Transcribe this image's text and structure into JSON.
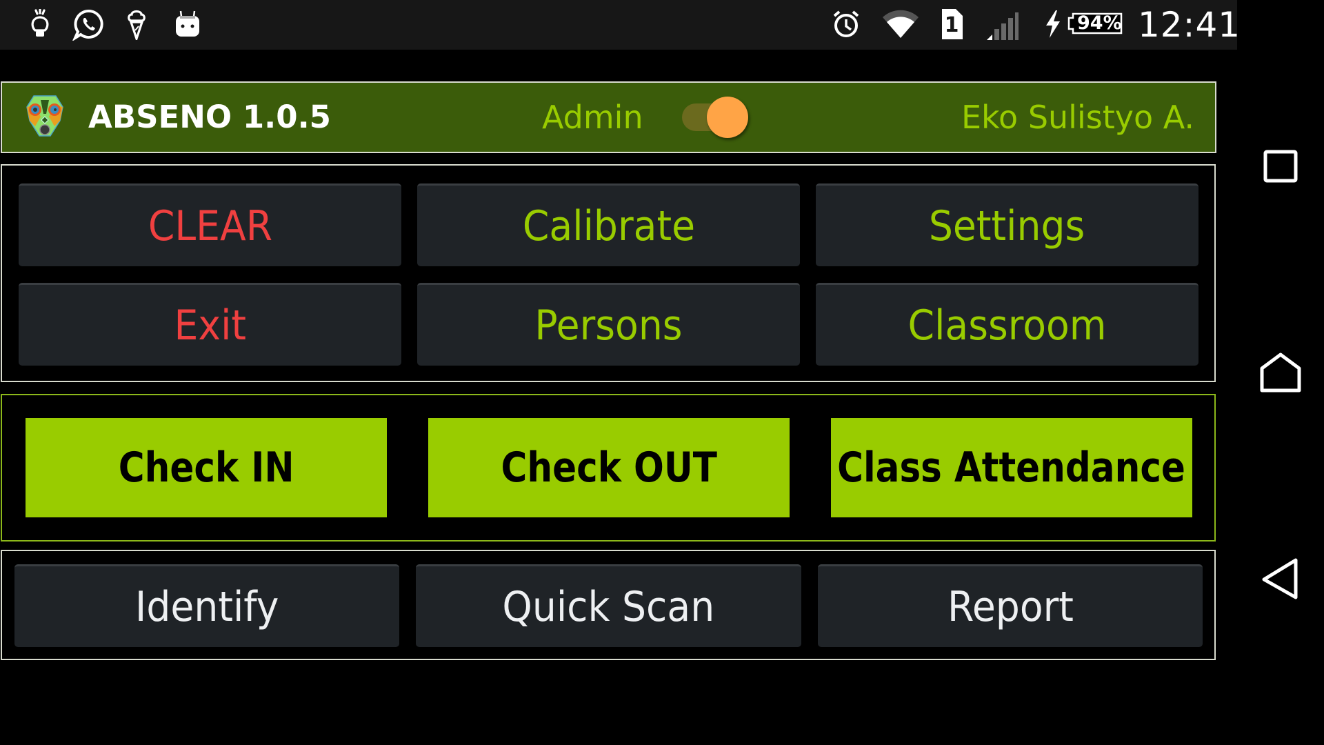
{
  "status_bar": {
    "left_icons": [
      "lightbulb-icon",
      "whatsapp-icon",
      "ice-cream-icon",
      "android-icon"
    ],
    "right_icons": [
      "alarm-icon",
      "wifi-icon",
      "sim-1-icon",
      "signal-icon",
      "charging-icon"
    ],
    "sim_number": "1",
    "battery_percent": "94%",
    "time": "12:41"
  },
  "header": {
    "app_title": "ABSENO 1.0.5",
    "role_label": "Admin",
    "admin_switch_on": true,
    "user_name": "Eko Sulistyo A."
  },
  "admin_panel": {
    "buttons": [
      {
        "label": "CLEAR",
        "color": "#f04040"
      },
      {
        "label": "Calibrate",
        "color": "#99cc00"
      },
      {
        "label": "Settings",
        "color": "#99cc00"
      },
      {
        "label": "Exit",
        "color": "#f04040"
      },
      {
        "label": "Persons",
        "color": "#99cc00"
      },
      {
        "label": "Classroom",
        "color": "#99cc00"
      }
    ]
  },
  "attendance_panel": {
    "accent_color": "#99cc00",
    "buttons": [
      {
        "label": "Check IN"
      },
      {
        "label": "Check OUT"
      },
      {
        "label": "Class Attendance"
      }
    ]
  },
  "tools_panel": {
    "buttons": [
      {
        "label": "Identify"
      },
      {
        "label": "Quick Scan"
      },
      {
        "label": "Report"
      }
    ]
  },
  "nav_bar": {
    "buttons": [
      "recents",
      "home",
      "back"
    ]
  }
}
